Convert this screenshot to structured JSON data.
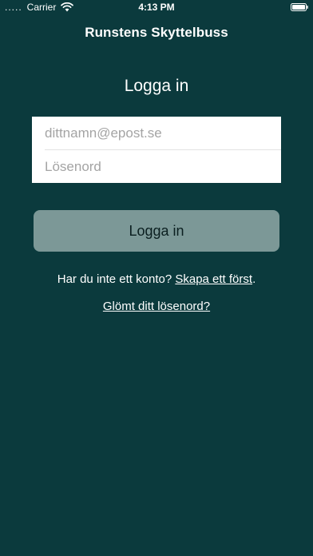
{
  "status_bar": {
    "signal": ".....",
    "carrier": "Carrier",
    "time": "4:13 PM"
  },
  "nav": {
    "title": "Runstens Skyttelbuss"
  },
  "login": {
    "heading": "Logga in",
    "email_placeholder": "dittnamn@epost.se",
    "password_placeholder": "Lösenord",
    "button_label": "Logga in"
  },
  "register": {
    "prompt": "Har du inte ett konto? ",
    "link_label": "Skapa ett först",
    "suffix": "."
  },
  "forgot": {
    "link_label": "Glömt ditt lösenord?"
  },
  "colors": {
    "background": "#0b3a3d",
    "button": "#7c9897",
    "text": "#ffffff"
  }
}
